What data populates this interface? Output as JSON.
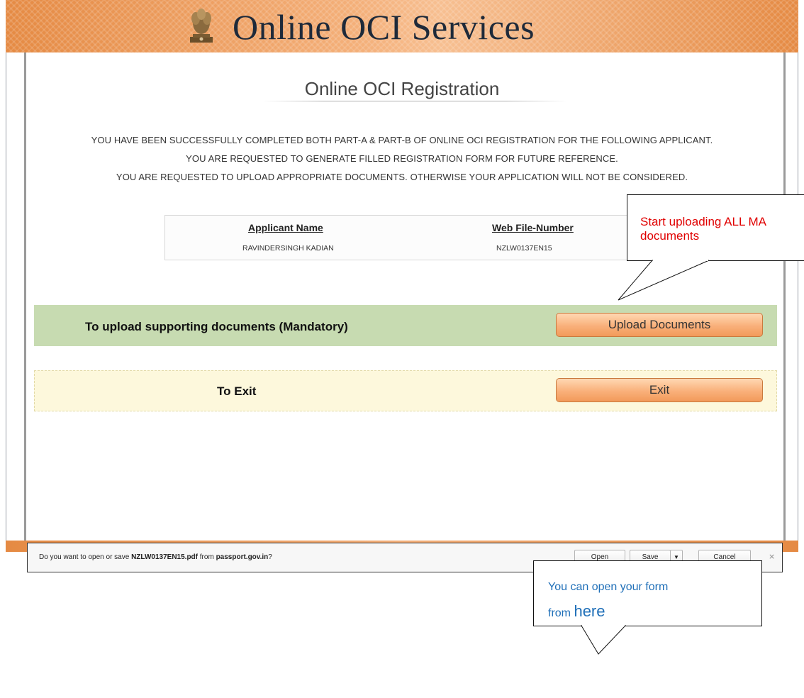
{
  "header": {
    "title": "Online OCI Services"
  },
  "page": {
    "heading": "Online OCI Registration"
  },
  "messages": [
    "YOU HAVE BEEN SUCCESSFULLY COMPLETED BOTH PART-A & PART-B OF ONLINE OCI REGISTRATION FOR THE FOLLOWING APPLICANT.",
    "YOU ARE REQUESTED TO GENERATE FILLED REGISTRATION FORM FOR FUTURE REFERENCE.",
    "YOU ARE REQUESTED TO UPLOAD APPROPRIATE DOCUMENTS. OTHERWISE YOUR APPLICATION WILL NOT BE CONSIDERED."
  ],
  "applicant": {
    "name_header": "Applicant Name",
    "name_value": "RAVINDERSINGH KADIAN",
    "file_header": "Web File-Number",
    "file_value": "NZLW0137EN15"
  },
  "actions": {
    "upload_label": "To upload supporting documents (Mandatory)",
    "upload_button": "Upload Documents",
    "exit_label": "To Exit",
    "exit_button": "Exit"
  },
  "download_bar": {
    "prompt_prefix": "Do you want to open or save ",
    "filename": "NZLW0137EN15.pdf",
    "prompt_middle": " from ",
    "domain": "passport.gov.in",
    "prompt_suffix": "?",
    "open_label": "Open",
    "save_label": "Save",
    "cancel_label": "Cancel",
    "close_symbol": "×",
    "dropdown_symbol": "▼"
  },
  "callouts": {
    "upload_hint": [
      "Start uploading ALL MA",
      "documents"
    ],
    "open_hint_line1": "You can open your form",
    "open_hint_line2_prefix": "from ",
    "open_hint_line2_emphasis": "here"
  },
  "colors": {
    "header_orange": "#e58a43",
    "button_orange": "#f9b07a",
    "upload_row_green": "#c7dbb1",
    "exit_row_cream": "#fdf8dc",
    "callout_red": "#e00000",
    "callout_blue": "#1f6fb8"
  }
}
